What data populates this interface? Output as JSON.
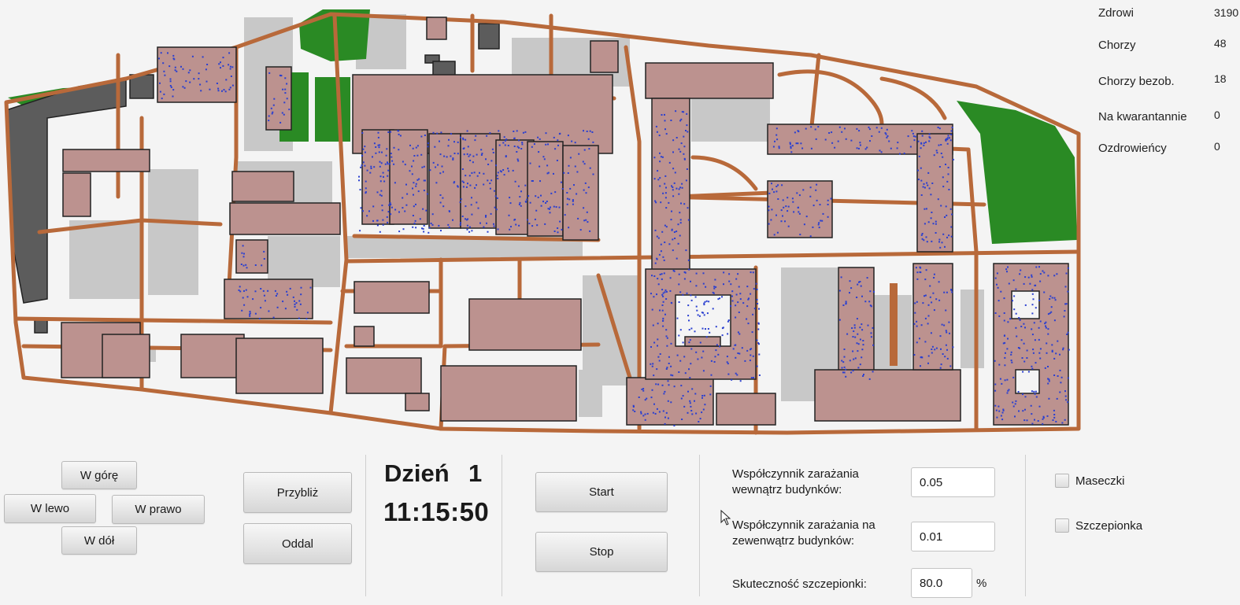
{
  "stats": [
    {
      "label": "Zdrowi",
      "value": "3190"
    },
    {
      "label": "Chorzy",
      "value": "48"
    },
    {
      "label": "Chorzy bezob.",
      "value": "18"
    },
    {
      "label": "Na kwarantannie",
      "value": "0"
    },
    {
      "label": "Ozdrowieńcy",
      "value": "0"
    }
  ],
  "navigation": {
    "up": "W górę",
    "left": "W lewo",
    "right": "W prawo",
    "down": "W dół"
  },
  "zoom": {
    "zoom_in": "Przybliż",
    "zoom_out": "Oddal"
  },
  "simulation": {
    "day_label": "Dzień",
    "day_number": "1",
    "time": "11:15:50",
    "start": "Start",
    "stop": "Stop"
  },
  "parameters": {
    "indoor_label_line1": "Współczynnik zarażania",
    "indoor_label_line2": "wewnątrz budynków:",
    "indoor_value": "0.05",
    "outdoor_label_line1": "Współczynnik zarażania na",
    "outdoor_label_line2": "zewenwątrz budynków:",
    "outdoor_value": "0.01",
    "vaccine_label": "Skuteczność szczepionki:",
    "vaccine_value": "80.0",
    "vaccine_unit": "%"
  },
  "toggles": {
    "masks": {
      "label": "Maseczki",
      "checked": false
    },
    "vaccine": {
      "label": "Szczepionka",
      "checked": false
    }
  },
  "map": {
    "colors": {
      "background": "#f4f4f4",
      "path": "#b8693a",
      "building": "#bc928f",
      "dark_building": "#5c5c5c",
      "green": "#2a8a24",
      "gray_area": "#c8c8c8",
      "person": "#2a3fd0"
    }
  }
}
